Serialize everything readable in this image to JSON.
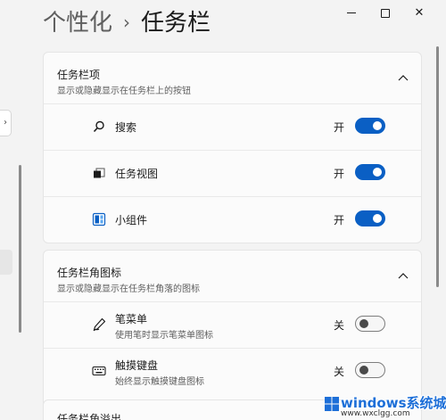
{
  "breadcrumb": {
    "parent": "个性化",
    "separator": "›",
    "current": "任务栏"
  },
  "title_bar": {
    "minimize_icon": "minimize-icon",
    "maximize_icon": "maximize-icon",
    "close_icon": "close-icon",
    "close_glyph": "✕"
  },
  "nav": {
    "collapse_glyph": "›"
  },
  "taskbar_items": {
    "title": "任务栏项",
    "subtitle": "显示或隐藏显示在任务栏上的按钮",
    "rows": [
      {
        "label": "搜索",
        "state": "开",
        "on": true,
        "icon": "search-icon"
      },
      {
        "label": "任务视图",
        "state": "开",
        "on": true,
        "icon": "task-view-icon"
      },
      {
        "label": "小组件",
        "state": "开",
        "on": true,
        "icon": "widgets-icon"
      }
    ]
  },
  "corner_icons": {
    "title": "任务栏角图标",
    "subtitle": "显示或隐藏显示在任务栏角落的图标",
    "rows": [
      {
        "label": "笔菜单",
        "sub": "使用笔时显示笔菜单图标",
        "state": "关",
        "on": false,
        "icon": "pen-icon"
      },
      {
        "label": "触摸键盘",
        "sub": "始终显示触摸键盘图标",
        "state": "关",
        "on": false,
        "icon": "keyboard-icon"
      }
    ]
  },
  "bottom_card": {
    "title": "任务栏角溢出"
  },
  "watermark": {
    "text": "windows系统城",
    "sub": "www.wxclgg.com"
  },
  "colors": {
    "accent": "#0a5fc4",
    "background": "#f3f3f3",
    "card": "#fbfbfb"
  }
}
